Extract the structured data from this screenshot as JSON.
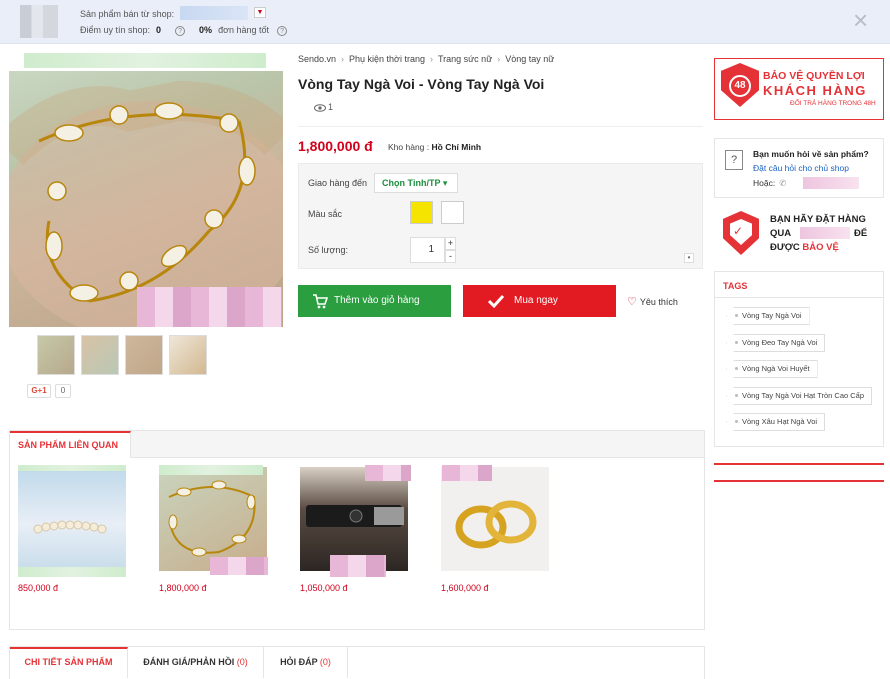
{
  "shop": {
    "sold_by_label": "Sản phẩm bán từ shop:",
    "rating_label": "Điểm uy tín shop:",
    "rating_value": "0",
    "good_percent": "0%",
    "good_label": "đơn hàng tốt",
    "dropdown_glyph": "▼",
    "help_glyph": "?",
    "close_glyph": "×"
  },
  "breadcrumb": {
    "items": [
      "Sendo.vn",
      "Phụ kiện thời trang",
      "Trang sức nữ",
      "Vòng tay nữ"
    ],
    "separator": "›"
  },
  "product": {
    "title": "Vòng Tay Ngà Voi - Vòng Tay Ngà Voi",
    "views": "1",
    "views_icon": "eye-icon",
    "price": "1,800,000 đ",
    "warehouse_label": "Kho hàng :",
    "warehouse_value": "Hồ Chí Minh"
  },
  "options": {
    "ship_label": "Giao hàng đến",
    "ship_select": "Chọn Tỉnh/TP ▾",
    "color_label": "Màu sắc",
    "colors": [
      "#f5e400",
      "#ffffff"
    ],
    "qty_label": "Số lượng:",
    "qty_value": "1",
    "qty_plus": "+",
    "qty_minus": "-",
    "chevron": "▾"
  },
  "actions": {
    "cart_label": "Thêm vào giỏ hàng",
    "buy_label": "Mua ngay",
    "fav_label": "Yêu thích",
    "cart_icon": "cart-icon",
    "buy_icon": "check-icon",
    "fav_icon": "heart-icon"
  },
  "social": {
    "gplus_label": "G+1",
    "gplus_count": "0"
  },
  "protection": {
    "hours": "48",
    "line1": "BẢO VỆ QUYỀN LỢI",
    "line2": "KHÁCH HÀNG",
    "line3": "ĐỔI TRẢ HÀNG TRONG 48H"
  },
  "ask": {
    "q_glyph": "?",
    "title": "Bạn muốn hỏi về sản phẩm?",
    "link": "Đặt câu hỏi cho chủ shop",
    "or_label": "Hoặc:",
    "phone_glyph": "✆"
  },
  "order_notice": {
    "line1": "BẠN HÃY ĐẶT HÀNG",
    "line2a": "QUA",
    "line2b": "ĐỂ",
    "line3a": "ĐƯỢC",
    "line3b": "BẢO VỆ"
  },
  "tags": {
    "title": "TAGS",
    "items": [
      "Vòng Tay Ngà Voi",
      "Vòng Đeo Tay Ngà Voi",
      "Vòng Ngà Voi Huyết",
      "Vòng Tay Ngà Voi Hạt Tròn Cao Cấp",
      "Vòng Xâu Hạt Ngà Voi"
    ]
  },
  "related": {
    "tab_label": "SẢN PHẨM LIÊN QUAN",
    "items": [
      {
        "price": "850,000 đ"
      },
      {
        "price": "1,800,000 đ"
      },
      {
        "price": "1,050,000 đ"
      },
      {
        "price": "1,600,000 đ"
      }
    ]
  },
  "detail_tabs": {
    "tab1": "CHI TIẾT SẢN PHẨM",
    "tab2": "ĐÁNH GIÁ/PHẢN HỒI",
    "tab2_count": "(0)",
    "tab3": "HỎI ĐÁP",
    "tab3_count": "(0)"
  }
}
